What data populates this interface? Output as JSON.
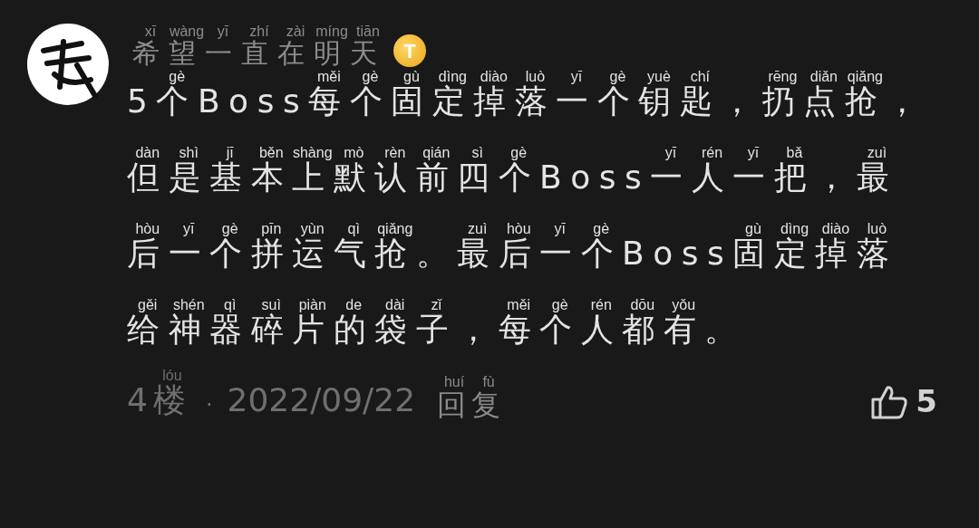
{
  "author": {
    "name": [
      {
        "t": "希",
        "py": "xī"
      },
      {
        "t": "望",
        "py": "wàng"
      },
      {
        "t": "一",
        "py": "yī"
      },
      {
        "t": "直",
        "py": "zhí"
      },
      {
        "t": "在",
        "py": "zài"
      },
      {
        "t": "明",
        "py": "míng"
      },
      {
        "t": "天",
        "py": "tiān"
      }
    ],
    "badge": "T"
  },
  "comment": [
    {
      "t": "5"
    },
    {
      "t": "个",
      "py": "gè"
    },
    {
      "t": "Boss"
    },
    {
      "t": "每",
      "py": "měi"
    },
    {
      "t": "个",
      "py": "gè"
    },
    {
      "t": "固",
      "py": "gù"
    },
    {
      "t": "定",
      "py": "dìng"
    },
    {
      "t": "掉",
      "py": "diào"
    },
    {
      "t": "落",
      "py": "luò"
    },
    {
      "t": "一",
      "py": "yī"
    },
    {
      "t": "个",
      "py": "gè"
    },
    {
      "t": "钥",
      "py": "yuè"
    },
    {
      "t": "匙",
      "py": "chí"
    },
    {
      "t": "，"
    },
    {
      "t": "扔",
      "py": "rēng"
    },
    {
      "t": "点",
      "py": "diǎn"
    },
    {
      "t": "抢",
      "py": "qiǎng"
    },
    {
      "t": "，"
    },
    {
      "t": "但",
      "py": "dàn"
    },
    {
      "t": "是",
      "py": "shì"
    },
    {
      "t": "基",
      "py": "jī"
    },
    {
      "t": "本",
      "py": "běn"
    },
    {
      "t": "上",
      "py": "shàng"
    },
    {
      "t": "默",
      "py": "mò"
    },
    {
      "t": "认",
      "py": "rèn"
    },
    {
      "t": "前",
      "py": "qián"
    },
    {
      "t": "四",
      "py": "sì"
    },
    {
      "t": "个",
      "py": "gè"
    },
    {
      "t": "Boss"
    },
    {
      "t": "一",
      "py": "yī"
    },
    {
      "t": "人",
      "py": "rén"
    },
    {
      "t": "一",
      "py": "yī"
    },
    {
      "t": "把",
      "py": "bǎ"
    },
    {
      "t": "，"
    },
    {
      "t": "最",
      "py": "zuì"
    },
    {
      "t": "后",
      "py": "hòu"
    },
    {
      "t": "一",
      "py": "yī"
    },
    {
      "t": "个",
      "py": "gè"
    },
    {
      "t": "拼",
      "py": "pīn"
    },
    {
      "t": "运",
      "py": "yùn"
    },
    {
      "t": "气",
      "py": "qì"
    },
    {
      "t": "抢",
      "py": "qiǎng"
    },
    {
      "t": "。"
    },
    {
      "t": "最",
      "py": "zuì"
    },
    {
      "t": "后",
      "py": "hòu"
    },
    {
      "t": "一",
      "py": "yī"
    },
    {
      "t": "个",
      "py": "gè"
    },
    {
      "t": "Boss"
    },
    {
      "t": "固",
      "py": "gù"
    },
    {
      "t": "定",
      "py": "dìng"
    },
    {
      "t": "掉",
      "py": "diào"
    },
    {
      "t": "落",
      "py": "luò"
    },
    {
      "t": "给",
      "py": "gěi"
    },
    {
      "t": "神",
      "py": "shén"
    },
    {
      "t": "器",
      "py": "qì"
    },
    {
      "t": "碎",
      "py": "suì"
    },
    {
      "t": "片",
      "py": "piàn"
    },
    {
      "t": "的",
      "py": "de"
    },
    {
      "t": "袋",
      "py": "dài"
    },
    {
      "t": "子",
      "py": "zǐ"
    },
    {
      "t": "，"
    },
    {
      "t": "每",
      "py": "měi"
    },
    {
      "t": "个",
      "py": "gè"
    },
    {
      "t": "人",
      "py": "rén"
    },
    {
      "t": "都",
      "py": "dōu"
    },
    {
      "t": "有",
      "py": "yǒu"
    },
    {
      "t": "。"
    }
  ],
  "footer": {
    "floor": [
      {
        "t": "4"
      },
      {
        "t": "楼",
        "py": "lóu"
      }
    ],
    "separator": "·",
    "date": "2022/09/22",
    "reply": [
      {
        "t": "回",
        "py": "huí"
      },
      {
        "t": "复",
        "py": "fù"
      }
    ],
    "likes": "5"
  }
}
